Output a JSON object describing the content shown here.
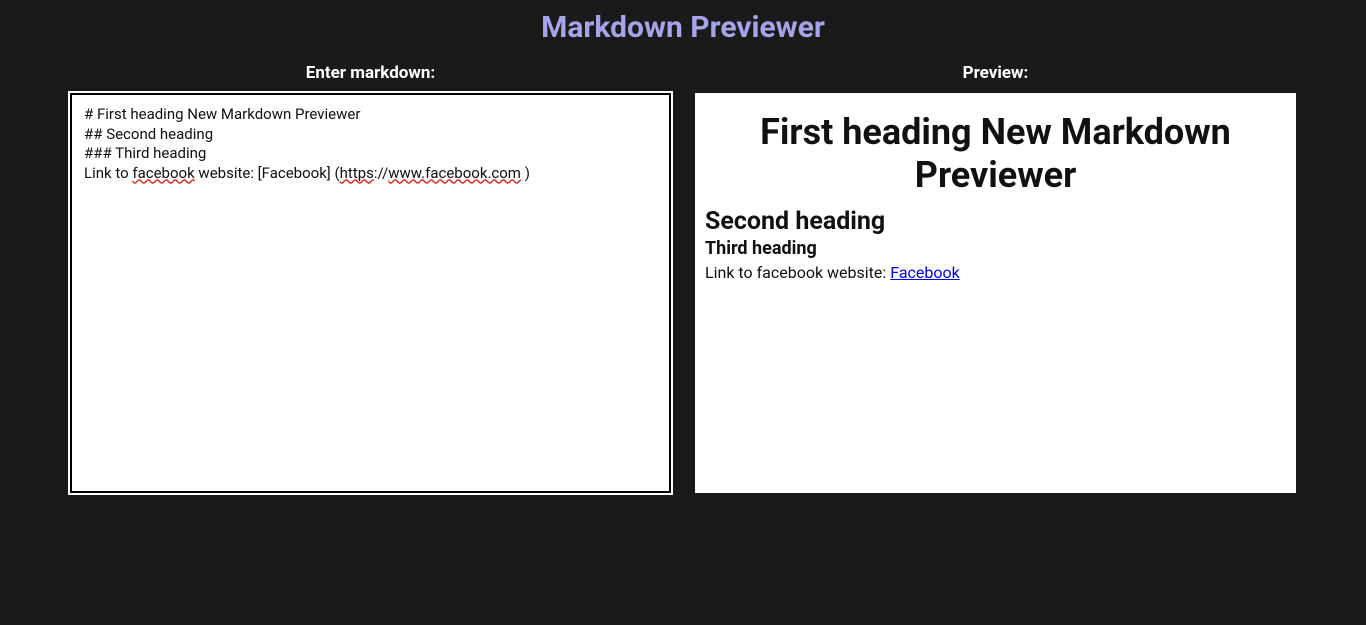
{
  "header": {
    "title": "Markdown Previewer"
  },
  "editor": {
    "label": "Enter markdown:",
    "lines": [
      {
        "segments": [
          {
            "text": "# First heading New Markdown Previewer"
          }
        ]
      },
      {
        "segments": [
          {
            "text": "## Second heading"
          }
        ]
      },
      {
        "segments": [
          {
            "text": "### Third heading"
          }
        ]
      },
      {
        "segments": [
          {
            "text": "Link to "
          },
          {
            "text": "facebook",
            "spell": true
          },
          {
            "text": " website: [Facebook] ("
          },
          {
            "text": "https",
            "spell": true
          },
          {
            "text": "://"
          },
          {
            "text": "www.facebook.com",
            "spell": true
          },
          {
            "text": " )"
          }
        ]
      }
    ]
  },
  "preview": {
    "label": "Preview:",
    "h1": "First heading New Markdown Previewer",
    "h2": "Second heading",
    "h3": "Third heading",
    "link_prefix": "Link to facebook website: ",
    "link_text": "Facebook",
    "link_href": "https://www.facebook.com"
  }
}
